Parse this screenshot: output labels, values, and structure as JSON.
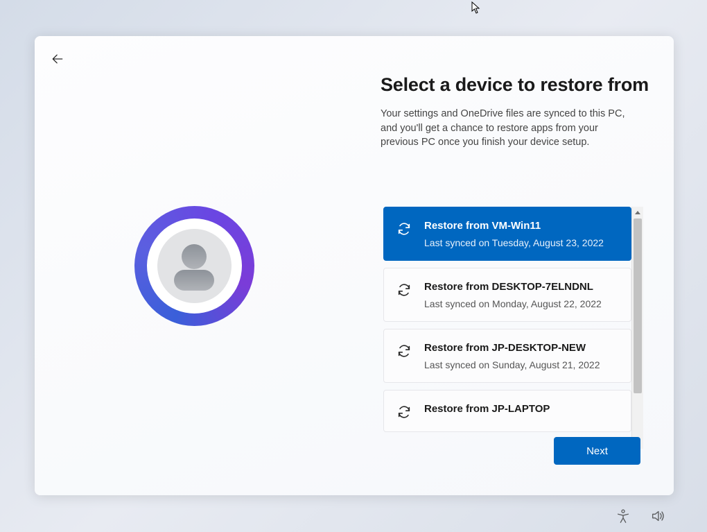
{
  "page": {
    "heading": "Select a device to restore from",
    "subtext": "Your settings and OneDrive files are synced to this PC, and you'll get a chance to restore apps from your previous PC once you finish your device setup."
  },
  "devices": [
    {
      "title": "Restore from VM-Win11",
      "synced": "Last synced on Tuesday, August 23, 2022",
      "selected": true
    },
    {
      "title": "Restore from DESKTOP-7ELNDNL",
      "synced": "Last synced on Monday, August 22, 2022",
      "selected": false
    },
    {
      "title": "Restore from JP-DESKTOP-NEW",
      "synced": "Last synced on Sunday, August 21, 2022",
      "selected": false
    },
    {
      "title": "Restore from JP-LAPTOP",
      "synced": "",
      "selected": false
    }
  ],
  "buttons": {
    "next": "Next"
  },
  "colors": {
    "accent": "#0067c0"
  }
}
